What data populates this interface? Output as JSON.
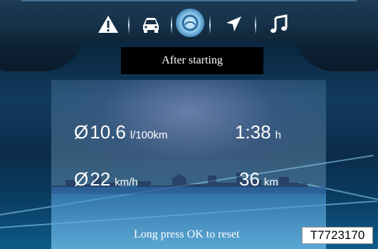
{
  "header": {
    "icons": [
      {
        "name": "warning-icon"
      },
      {
        "name": "vehicle-icon"
      },
      {
        "name": "trip-computer-icon",
        "selected": true
      },
      {
        "name": "navigation-icon"
      },
      {
        "name": "music-icon"
      }
    ]
  },
  "status": {
    "label": "After starting"
  },
  "trip": {
    "fuel": {
      "symbol": "Ø",
      "value": "10.6",
      "unit": "l/100km"
    },
    "time": {
      "value": "1:38",
      "unit": "h"
    },
    "speed": {
      "symbol": "Ø",
      "value": "22",
      "unit": "km/h"
    },
    "distance": {
      "value": "36",
      "unit": "km"
    }
  },
  "footer": {
    "hint": "Long press OK to reset",
    "code": "T7723170"
  },
  "colors": {
    "accent": "#8fc8ec",
    "text": "#ffffff",
    "background": "#0a2a44"
  }
}
